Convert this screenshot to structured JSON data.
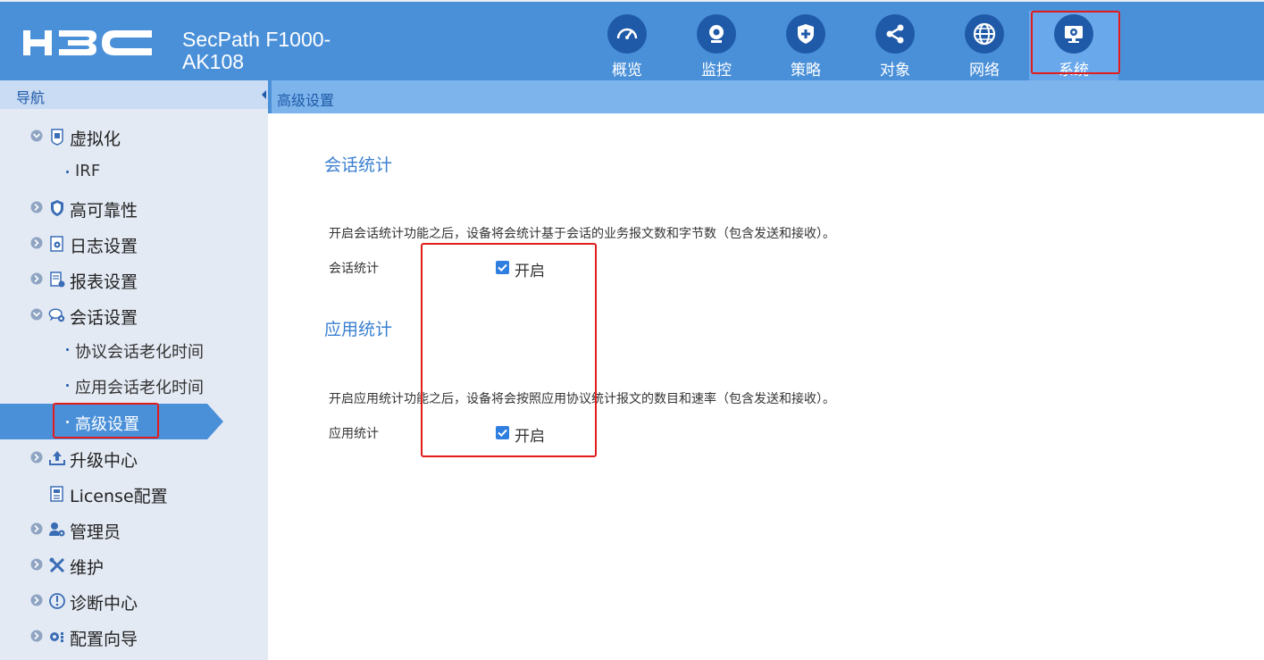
{
  "header": {
    "brand": "H3C",
    "product_line1": "SecPath F1000-",
    "product_line2": "AK108",
    "tabs": [
      {
        "label": "概览",
        "icon": "gauge-icon"
      },
      {
        "label": "监控",
        "icon": "camera-icon"
      },
      {
        "label": "策略",
        "icon": "shield-plus-icon"
      },
      {
        "label": "对象",
        "icon": "share-icon"
      },
      {
        "label": "网络",
        "icon": "globe-icon"
      },
      {
        "label": "系统",
        "icon": "monitor-gear-icon",
        "active": true
      }
    ]
  },
  "sidebar": {
    "title": "导航",
    "items": [
      {
        "label": "虚拟化",
        "icon": "virtualization-icon"
      },
      {
        "label": "IRF"
      },
      {
        "label": "高可靠性",
        "icon": "shield-icon"
      },
      {
        "label": "日志设置",
        "icon": "log-gear-icon"
      },
      {
        "label": "报表设置",
        "icon": "report-icon"
      },
      {
        "label": "会话设置",
        "icon": "session-icon"
      },
      {
        "label": "协议会话老化时间"
      },
      {
        "label": "应用会话老化时间"
      },
      {
        "label": "高级设置",
        "selected": true
      },
      {
        "label": "升级中心",
        "icon": "upload-icon"
      },
      {
        "label": "License配置",
        "icon": "license-icon"
      },
      {
        "label": "管理员",
        "icon": "admin-icon"
      },
      {
        "label": "维护",
        "icon": "tools-icon"
      },
      {
        "label": "诊断中心",
        "icon": "diagnostic-icon"
      },
      {
        "label": "配置向导",
        "icon": "wizard-icon"
      }
    ]
  },
  "content": {
    "breadcrumb": "高级设置",
    "session_stats": {
      "title": "会话统计",
      "description": "开启会话统计功能之后，设备将会统计基于会话的业务报文数和字节数（包含发送和接收）。",
      "field_label": "会话统计",
      "checkbox_label": "开启",
      "checked": true
    },
    "app_stats": {
      "title": "应用统计",
      "description": "开启应用统计功能之后，设备将会按照应用协议统计报文的数目和速率（包含发送和接收）。",
      "field_label": "应用统计",
      "checkbox_label": "开启",
      "checked": true
    }
  },
  "colors": {
    "header_bg": "#4a90d9",
    "icon_circle": "#1f5aa8",
    "sidebar_bg": "#e4eaf4",
    "selected_item": "#4a90d9",
    "highlight": "#e21b1b",
    "checkbox": "#2f7fe0"
  }
}
